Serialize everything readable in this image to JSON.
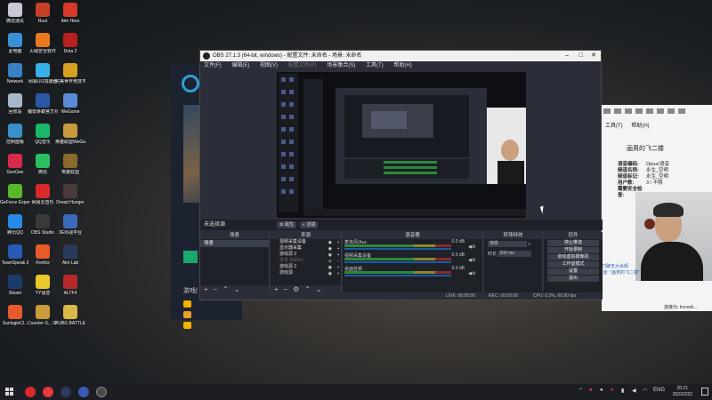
{
  "desktop": {
    "icons": [
      {
        "label": "微信通关",
        "color": "#c8c8d8"
      },
      {
        "label": "Rust",
        "color": "#c8402a"
      },
      {
        "label": "Aim Hero",
        "color": "#d83a2a"
      },
      {
        "label": "此电脑",
        "color": "#3a90d8"
      },
      {
        "label": "火绒安全软件",
        "color": "#e87820"
      },
      {
        "label": "Dota 2",
        "color": "#b82020"
      },
      {
        "label": "Network",
        "color": "#3a80c8"
      },
      {
        "label": "网易UU加速器",
        "color": "#3ab0e8"
      },
      {
        "label": "完美世界竞技平台",
        "color": "#d8a020"
      },
      {
        "label": "回收站",
        "color": "#a8b8c8"
      },
      {
        "label": "魔兽争霸官方对战平台",
        "color": "#2a58a8"
      },
      {
        "label": "WeGame",
        "color": "#5a8ad8"
      },
      {
        "label": "控制面板",
        "color": "#3a90c8"
      },
      {
        "label": "QQ音乐",
        "color": "#1ab868"
      },
      {
        "label": "英雄联盟WeGame版",
        "color": "#c89a3a"
      },
      {
        "label": "GeeGee",
        "color": "#d82a4a"
      },
      {
        "label": "微信",
        "color": "#2ac060"
      },
      {
        "label": "英雄联盟",
        "color": "#8a6a2a"
      },
      {
        "label": "GeForce Experience",
        "color": "#5ab82a"
      },
      {
        "label": "网易云音乐",
        "color": "#d82a2a"
      },
      {
        "label": "Dread Hunger",
        "color": "#4a3a3a"
      },
      {
        "label": "腾讯QQ",
        "color": "#2a8ae8"
      },
      {
        "label": "OBS Studio",
        "color": "#3a3a3a"
      },
      {
        "label": "3E对战平台",
        "color": "#3a6ab8"
      },
      {
        "label": "TeamSpeak 3",
        "color": "#2a5ab8"
      },
      {
        "label": "Firefox",
        "color": "#e85a2a"
      },
      {
        "label": "Aim Lab",
        "color": "#2a3a5a"
      },
      {
        "label": "Steam",
        "color": "#1a3a6a"
      },
      {
        "label": "YY语音",
        "color": "#e8c82a"
      },
      {
        "label": "ALTF4",
        "color": "#b82a2a"
      },
      {
        "label": "SunloginCl...",
        "color": "#e85a2a"
      },
      {
        "label": "Counter-S... Global Off...",
        "color": "#c89a3a"
      },
      {
        "label": "PUBG BATTLEGR...",
        "color": "#d8b84a"
      }
    ]
  },
  "launcher": {
    "section_label": "游戏(",
    "brand_color": "#2aa0d8"
  },
  "stream": {
    "menu": [
      "工具(T)",
      "帮助(H)"
    ],
    "title": "画男的飞二楼",
    "info": [
      {
        "k": "语音编码:",
        "v": "Opus(语音"
      },
      {
        "k": "频道名称:",
        "v": "永生_空明"
      },
      {
        "k": "频道标记:",
        "v": "永生_空明"
      },
      {
        "k": "用户数:",
        "v": "3 / 不限"
      },
      {
        "k": "需要安全检查:",
        "v": "否"
      }
    ],
    "chat_lines": [
      "刀聊天大会频",
      "[道: \"画男的飞二楼\""
    ],
    "connection": "连接为: Incredi..."
  },
  "obs": {
    "title": "OBS 27.1.3 (64-bit, windows) - 配置文件: 未命名 - 场景: 未命名",
    "menu": [
      "文件(F)",
      "编辑(E)",
      "视图(V)",
      "配置文件(P)",
      "场景集合(S)",
      "工具(T)",
      "帮助(H)"
    ],
    "no_source": "未选择源",
    "props_label": "属性",
    "filters_label": "滤镜",
    "docks": {
      "scenes": {
        "header": "场景",
        "items": [
          "场景"
        ]
      },
      "sources": {
        "header": "来源",
        "items": [
          "视频采集设备",
          "显示器采集",
          "游戏源 3",
          "文本 (GDI+)",
          "游戏源 2",
          "游戏源"
        ]
      },
      "mixer": {
        "header": "混音器",
        "tracks": [
          {
            "name": "麦克风/Aux",
            "db": "0.0 dB"
          },
          {
            "name": "视频采集设备",
            "db": "0.0 dB"
          },
          {
            "name": "桌面音频",
            "db": "0.0 dB"
          }
        ]
      },
      "transitions": {
        "header": "转场特效",
        "type": "渐变",
        "duration_label": "时长",
        "duration": "300 ms"
      },
      "controls": {
        "header": "控件",
        "buttons": [
          "停止推流",
          "开始录制",
          "启动虚拟摄像机",
          "工作室模式",
          "设置",
          "退出"
        ]
      }
    },
    "status": {
      "live": "LIVE: 00:00:00",
      "rec": "REC: 00:00:00",
      "cpu": "CPU: 0.3%, 60.00 fps"
    }
  },
  "taskbar": {
    "time": "20:21",
    "date": "2022/2/22",
    "lang": "ENG"
  }
}
